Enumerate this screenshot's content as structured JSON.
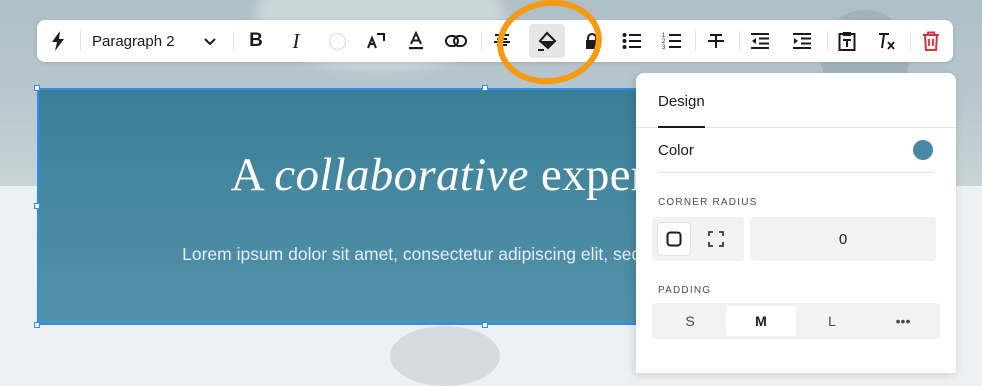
{
  "toolbar": {
    "paragraph_style": "Paragraph 2",
    "icons": [
      "lightning-icon",
      "chevron-down-icon",
      "bold-icon",
      "italic-icon",
      "text-color-icon",
      "text-size-icon",
      "text-highlight-icon",
      "link-icon",
      "align-icon",
      "fill-icon",
      "lock-icon",
      "bulleted-list-icon",
      "numbered-list-icon",
      "strikethrough-icon",
      "outdent-icon",
      "indent-icon",
      "paste-text-icon",
      "clear-format-icon",
      "trash-icon"
    ],
    "bold_glyph": "B",
    "italic_glyph": "I"
  },
  "block": {
    "headline_pre": "A ",
    "headline_em": "collaborative",
    "headline_post": " experience",
    "body": "Lorem ipsum dolor sit amet, consectetur adipiscing elit, sed do eiusmod tempor"
  },
  "panel": {
    "tab": "Design",
    "color_label": "Color",
    "color_value": "#4a89a6",
    "corner_radius_label": "CORNER RADIUS",
    "corner_radius_value": "0",
    "padding_label": "PADDING",
    "padding_options": [
      "S",
      "M",
      "L",
      "•••"
    ],
    "padding_selected": "M"
  },
  "colors": {
    "accent_selection": "#2a8ff0",
    "annotation": "#f59a12",
    "delete": "#d8333a"
  }
}
